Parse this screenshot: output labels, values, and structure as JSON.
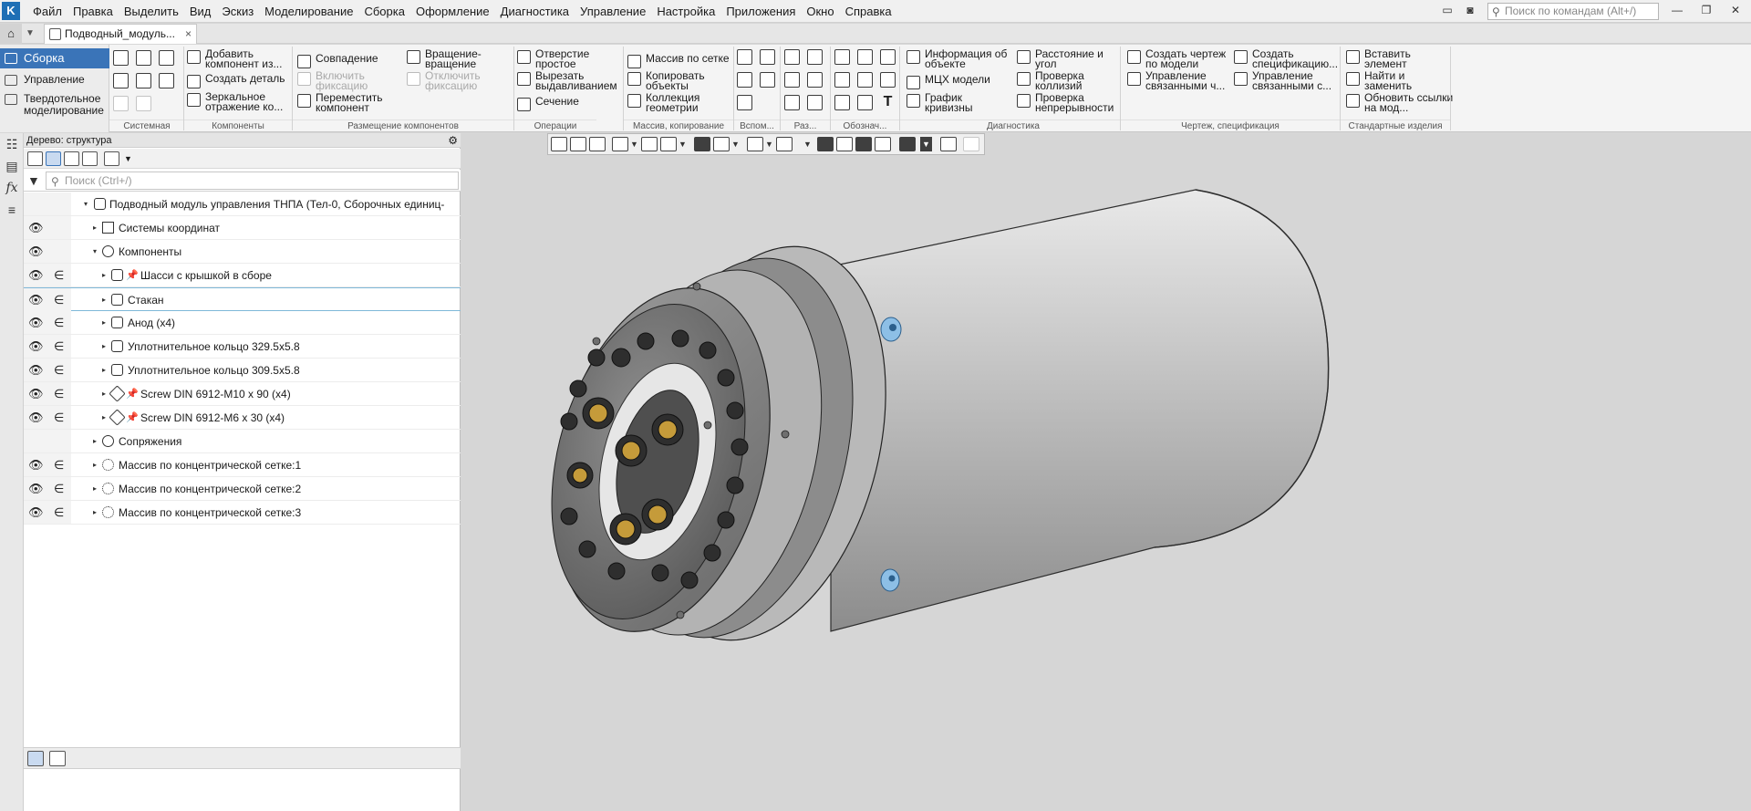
{
  "menubar": {
    "items": [
      "Файл",
      "Правка",
      "Выделить",
      "Вид",
      "Эскиз",
      "Моделирование",
      "Сборка",
      "Оформление",
      "Диагностика",
      "Управление",
      "Настройка",
      "Приложения",
      "Окно",
      "Справка"
    ],
    "search_placeholder": "Поиск по командам (Alt+/)"
  },
  "tabs": {
    "document_tab": "Подводный_модуль...",
    "close_glyph": "×"
  },
  "modes": {
    "active": "Сборка",
    "items": [
      "Управление",
      "Твердотельное моделирование"
    ]
  },
  "ribbon": {
    "groups": {
      "system": "Системная",
      "components": "Компоненты",
      "placement": "Размещение компонентов",
      "operations": "Операции",
      "arrays": "Массив, копирование",
      "aux": "Вспом...",
      "size": "Раз...",
      "notation": "Обознач...",
      "diagnostics": "Диагностика",
      "drawing_spec": "Чертеж, спецификация",
      "standard": "Стандартные изделия"
    },
    "buttons": {
      "add_component": "Добавить компонент из...",
      "create_part": "Создать деталь",
      "mirror": "Зеркальное отражение ко...",
      "coincidence": "Совпадение",
      "enable_fix": "Включить фиксацию",
      "move_component": "Переместить компонент",
      "rotation": "Вращение-вращение",
      "disable_fix": "Отключить фиксацию",
      "simple_hole": "Отверстие простое",
      "extrude_cut": "Вырезать выдавливанием",
      "section": "Сечение",
      "grid_array": "Массив по сетке",
      "copy_objects": "Копировать объекты",
      "geometry_collection": "Коллекция геометрии",
      "object_info": "Информация об объекте",
      "mcx_model": "МЦХ модели",
      "curvature_graph": "График кривизны",
      "distance_angle": "Расстояние и угол",
      "collision_check": "Проверка коллизий",
      "continuity_check": "Проверка непрерывности",
      "create_drawing": "Создать чертеж по модели",
      "manage_linked_1": "Управление связанными ч...",
      "create_spec": "Создать спецификацию...",
      "manage_linked_2": "Управление связанными с...",
      "insert_element": "Вставить элемент",
      "find_replace": "Найти и заменить",
      "update_links": "Обновить ссылки на мод..."
    }
  },
  "tree": {
    "title": "Дерево: структура",
    "search_placeholder": "Поиск (Ctrl+/)",
    "root": "Подводный модуль управления ТНПА (Тел-0, Сборочных единиц-",
    "rows": [
      "Системы координат",
      "Компоненты",
      "Шасси с крышкой в сборе",
      "Стакан",
      "Анод (x4)",
      "Уплотнительное кольцо 329.5x5.8",
      "Уплотнительное кольцо 309.5x5.8",
      "Screw DIN 6912-M10 x 90 (x4)",
      "Screw DIN 6912-M6 x 30 (x4)",
      "Сопряжения",
      "Массив по концентрической сетке:1",
      "Массив по концентрической сетке:2",
      "Массив по концентрической сетке:3"
    ]
  },
  "glyphs": {
    "eye": "👁",
    "include": "∈",
    "expand": "▸",
    "collapse": "▾",
    "pin": "📌",
    "fx": "fx"
  },
  "icons": [
    "app-logo-icon",
    "home-icon",
    "search-icon",
    "gear-icon",
    "filter-icon",
    "eye-icon",
    "include-icon",
    "pin-icon",
    "cylinder-3d-model"
  ],
  "colors": {
    "accent": "#3a74b8",
    "selection_line": "#7fb8d8",
    "viewport_bg": "#d6d6d6"
  }
}
